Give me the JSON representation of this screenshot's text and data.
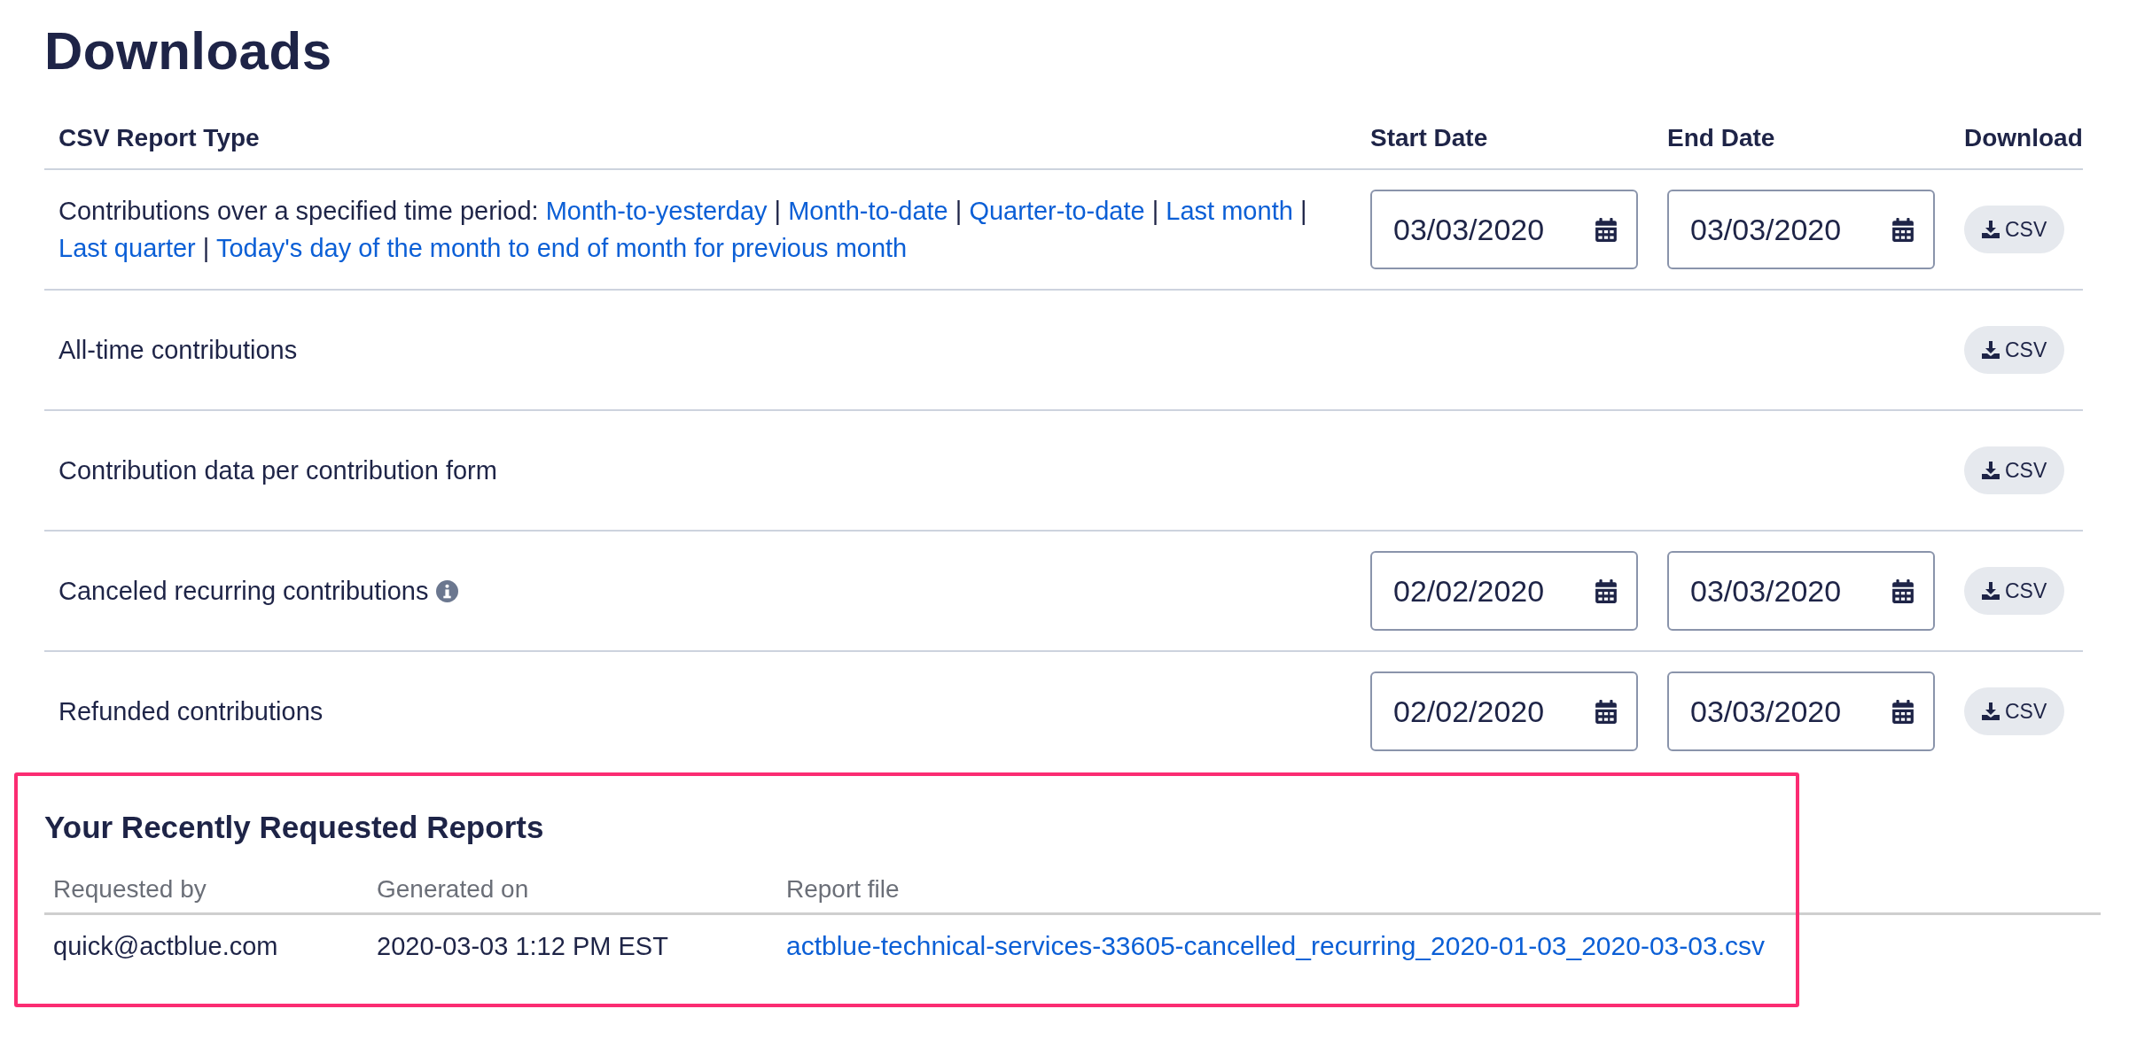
{
  "title": "Downloads",
  "table": {
    "columns": [
      "CSV Report Type",
      "Start Date",
      "End Date",
      "Download"
    ],
    "rows": [
      {
        "description": [
          {
            "text": "Contributions over a specified time period:",
            "kind": "text"
          },
          {
            "text": "Month-to-yesterday",
            "kind": "link"
          },
          {
            "text": "|",
            "kind": "text"
          },
          {
            "text": "Month-to-date",
            "kind": "link"
          },
          {
            "text": "|",
            "kind": "text"
          },
          {
            "text": "Quarter-to-date",
            "kind": "link"
          },
          {
            "text": "|",
            "kind": "text"
          },
          {
            "text": "Last month",
            "kind": "link"
          },
          {
            "text": "|",
            "kind": "text"
          },
          {
            "text": "Last quarter",
            "kind": "link"
          },
          {
            "text": "|",
            "kind": "text"
          },
          {
            "text": "Today's day of the month to end of month for previous month",
            "kind": "link"
          }
        ],
        "info_icon": false,
        "start_date": "03/03/2020",
        "end_date": "03/03/2020",
        "button": "CSV"
      },
      {
        "description": [
          {
            "text": "All-time contributions",
            "kind": "text"
          }
        ],
        "info_icon": false,
        "button": "CSV"
      },
      {
        "description": [
          {
            "text": "Contribution data per contribution form",
            "kind": "text"
          }
        ],
        "info_icon": false,
        "button": "CSV"
      },
      {
        "description": [
          {
            "text": "Canceled recurring contributions",
            "kind": "text"
          }
        ],
        "info_icon": true,
        "start_date": "02/02/2020",
        "end_date": "03/03/2020",
        "button": "CSV"
      },
      {
        "description": [
          {
            "text": "Refunded contributions",
            "kind": "text"
          }
        ],
        "info_icon": false,
        "start_date": "02/02/2020",
        "end_date": "03/03/2020",
        "button": "CSV"
      }
    ]
  },
  "recent_reports": {
    "title": "Your Recently Requested Reports",
    "highlighted": true,
    "columns": [
      "Requested by",
      "Generated on",
      "Report file"
    ],
    "rows": [
      {
        "requested_by": "quick@actblue.com",
        "generated_on": "2020-03-03 1:12 PM EST",
        "report_file": "actblue-technical-services-33605-cancelled_recurring_2020-01-03_2020-03-03.csv"
      }
    ]
  }
}
